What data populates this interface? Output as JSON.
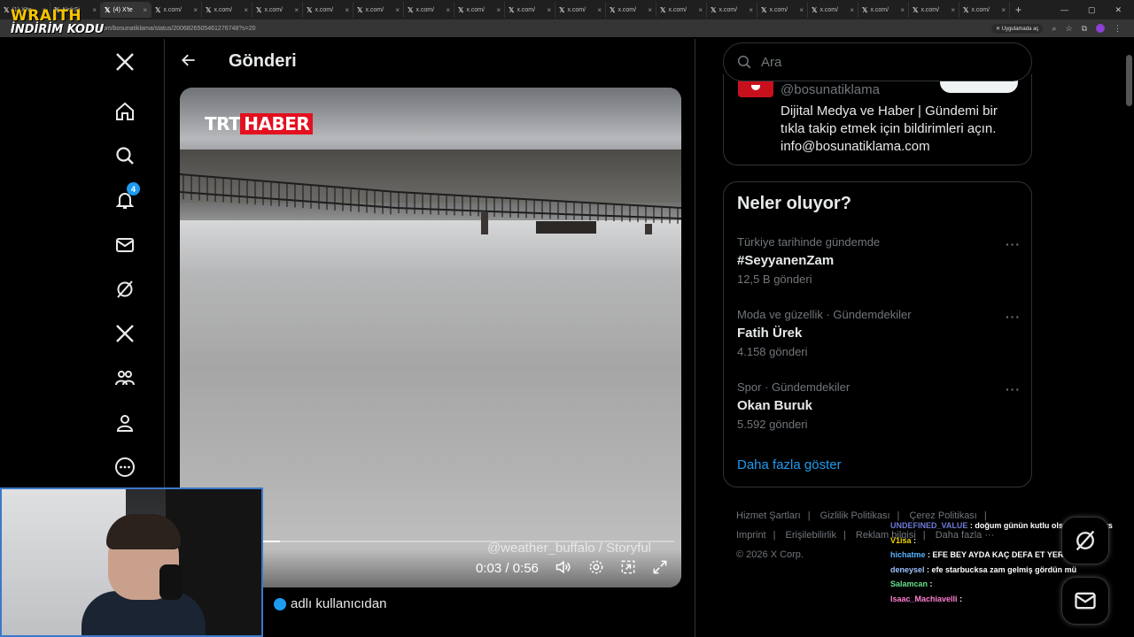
{
  "browser": {
    "tabs": [
      {
        "label": "(1) X'te"
      },
      {
        "label": "KickSi"
      },
      {
        "label": "(4) X'te",
        "active": true
      },
      {
        "label": "x.com/"
      },
      {
        "label": "x.com/"
      },
      {
        "label": "x.com/"
      },
      {
        "label": "x.com/"
      },
      {
        "label": "x.com/"
      },
      {
        "label": "x.com/"
      },
      {
        "label": "x.com/"
      },
      {
        "label": "x.com/"
      },
      {
        "label": "x.com/"
      },
      {
        "label": "x.com/"
      },
      {
        "label": "x.com/"
      },
      {
        "label": "x.com/"
      },
      {
        "label": "x.com/"
      },
      {
        "label": "x.com/"
      },
      {
        "label": "x.com/"
      },
      {
        "label": "x.com/"
      },
      {
        "label": "x.com/"
      }
    ],
    "new_tab": "+",
    "url": "x.com/bosunatiklama/status/2006826505461276748?s=20",
    "open_in_app": "Uygulamada aç"
  },
  "overlay_logo": {
    "line1": "WRAITH",
    "line2": "İNDİRİM KODU"
  },
  "nav": {
    "notification_count": "4"
  },
  "post": {
    "title": "Gönderi",
    "video": {
      "channel_logo_left": "TRT",
      "channel_logo_right": "HABER",
      "watermark": "@weather_buffalo / Storyful",
      "time": "0:03 / 0:56",
      "progress_fraction": 0.054
    },
    "from_user_text": "adlı kullanıcıdan"
  },
  "right": {
    "search_placeholder": "Ara",
    "profile": {
      "handle": "@bosunatiklama",
      "bio": "Dijital Medya ve Haber | Gündemi bir tıkla takip etmek için bildirimleri açın. info@bosunatiklama.com"
    },
    "trends_title": "Neler oluyor?",
    "trends": [
      {
        "context": "Türkiye tarihinde gündemde",
        "name": "#SeyyanenZam",
        "count": "12,5 B gönderi"
      },
      {
        "context": "Moda ve güzellik · Gündemdekiler",
        "name": "Fatih Ürek",
        "count": "4.158 gönderi"
      },
      {
        "context": "Spor · Gündemdekiler",
        "name": "Okan Buruk",
        "count": "5.592 gönderi"
      }
    ],
    "show_more": "Daha fazla göster",
    "footer": {
      "links": [
        "Hizmet Şartları",
        "Gizlilik Politikası",
        "Çerez Politikası",
        "Imprint",
        "Erişilebilirlik",
        "Reklam bilgisi",
        "Daha fazla ···"
      ],
      "copyright": "© 2026 X Corp."
    }
  },
  "chat": [
    {
      "user": "UNDEFINED_VALUE",
      "msg": ": doğum günün kutlu olsun uzay cavs"
    },
    {
      "user": "V1isa",
      "msg": ": "
    },
    {
      "user": "hichatme",
      "msg": ": EFE BEY AYDA KAÇ DEFA ET YERSİNİZ"
    },
    {
      "user": "deneysel",
      "msg": ": efe starbucksa zam gelmiş gördün mü"
    },
    {
      "user": "Salamcan",
      "msg": ": "
    },
    {
      "user": "Isaac_Machiavelli",
      "msg": ": "
    }
  ]
}
